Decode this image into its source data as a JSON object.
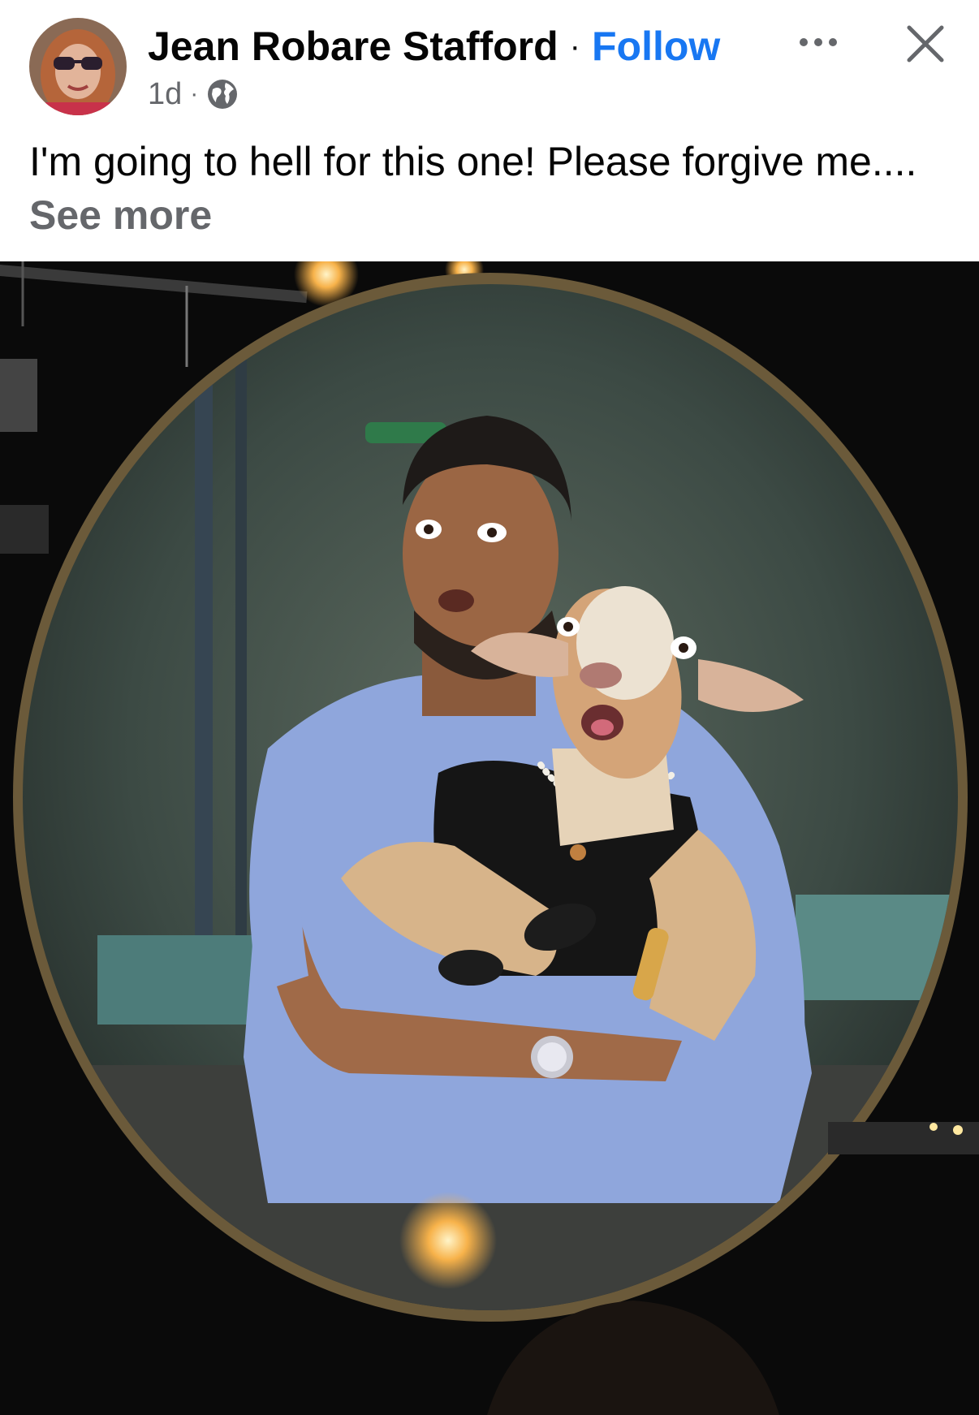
{
  "post": {
    "author_name": "Jean Robare Stafford",
    "separator": "·",
    "follow_label": "Follow",
    "timestamp": "1d",
    "meta_separator": "·",
    "privacy_icon": "globe-icon",
    "more_icon": "more-options-icon",
    "close_icon": "close-icon",
    "caption_text": "I'm going to hell for this one!  Please forgive me....",
    "see_more_label": "See more"
  },
  "colors": {
    "link_blue": "#1877f2",
    "text_primary": "#050505",
    "text_secondary": "#65676b",
    "photo_background": "#080808"
  }
}
